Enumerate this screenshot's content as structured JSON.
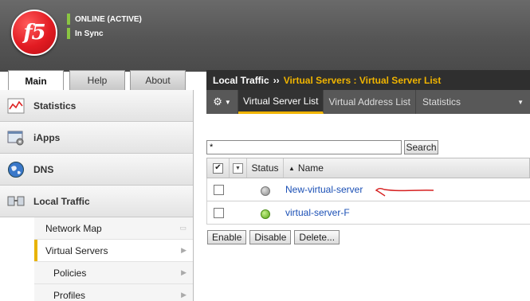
{
  "header": {
    "logo_text": "f5",
    "status_online": "ONLINE (ACTIVE)",
    "status_sync": "In Sync",
    "status_color": "#8ac542",
    "brand_color": "#e21b22"
  },
  "top_tabs": [
    {
      "label": "Main",
      "active": true
    },
    {
      "label": "Help",
      "active": false
    },
    {
      "label": "About",
      "active": false
    }
  ],
  "sidebar": {
    "categories": [
      {
        "label": "Statistics",
        "icon": "statistics-icon"
      },
      {
        "label": "iApps",
        "icon": "iapps-icon"
      },
      {
        "label": "DNS",
        "icon": "dns-globe-icon"
      },
      {
        "label": "Local Traffic",
        "icon": "local-traffic-icon"
      }
    ],
    "local_traffic_items": [
      {
        "label": "Network Map"
      },
      {
        "label": "Virtual Servers",
        "active": true
      },
      {
        "label": "Policies"
      },
      {
        "label": "Profiles"
      }
    ]
  },
  "breadcrumb": {
    "root": "Local Traffic",
    "separator": "››",
    "path": "Virtual Servers : Virtual Server List"
  },
  "subtabs": [
    {
      "label": "Virtual Server List",
      "active": true
    },
    {
      "label": "Virtual Address List",
      "active": false
    },
    {
      "label": "Statistics",
      "active": false
    }
  ],
  "search": {
    "value": "*",
    "button_label": "Search"
  },
  "table": {
    "columns": {
      "status": "Status",
      "name": "Name",
      "name_sort_indicator": "▲"
    },
    "rows": [
      {
        "name": "New-virtual-server",
        "status": "gray"
      },
      {
        "name": "virtual-server-F",
        "status": "green"
      }
    ]
  },
  "actions": {
    "enable": "Enable",
    "disable": "Disable",
    "delete": "Delete..."
  },
  "accent_color": "#f0b400"
}
